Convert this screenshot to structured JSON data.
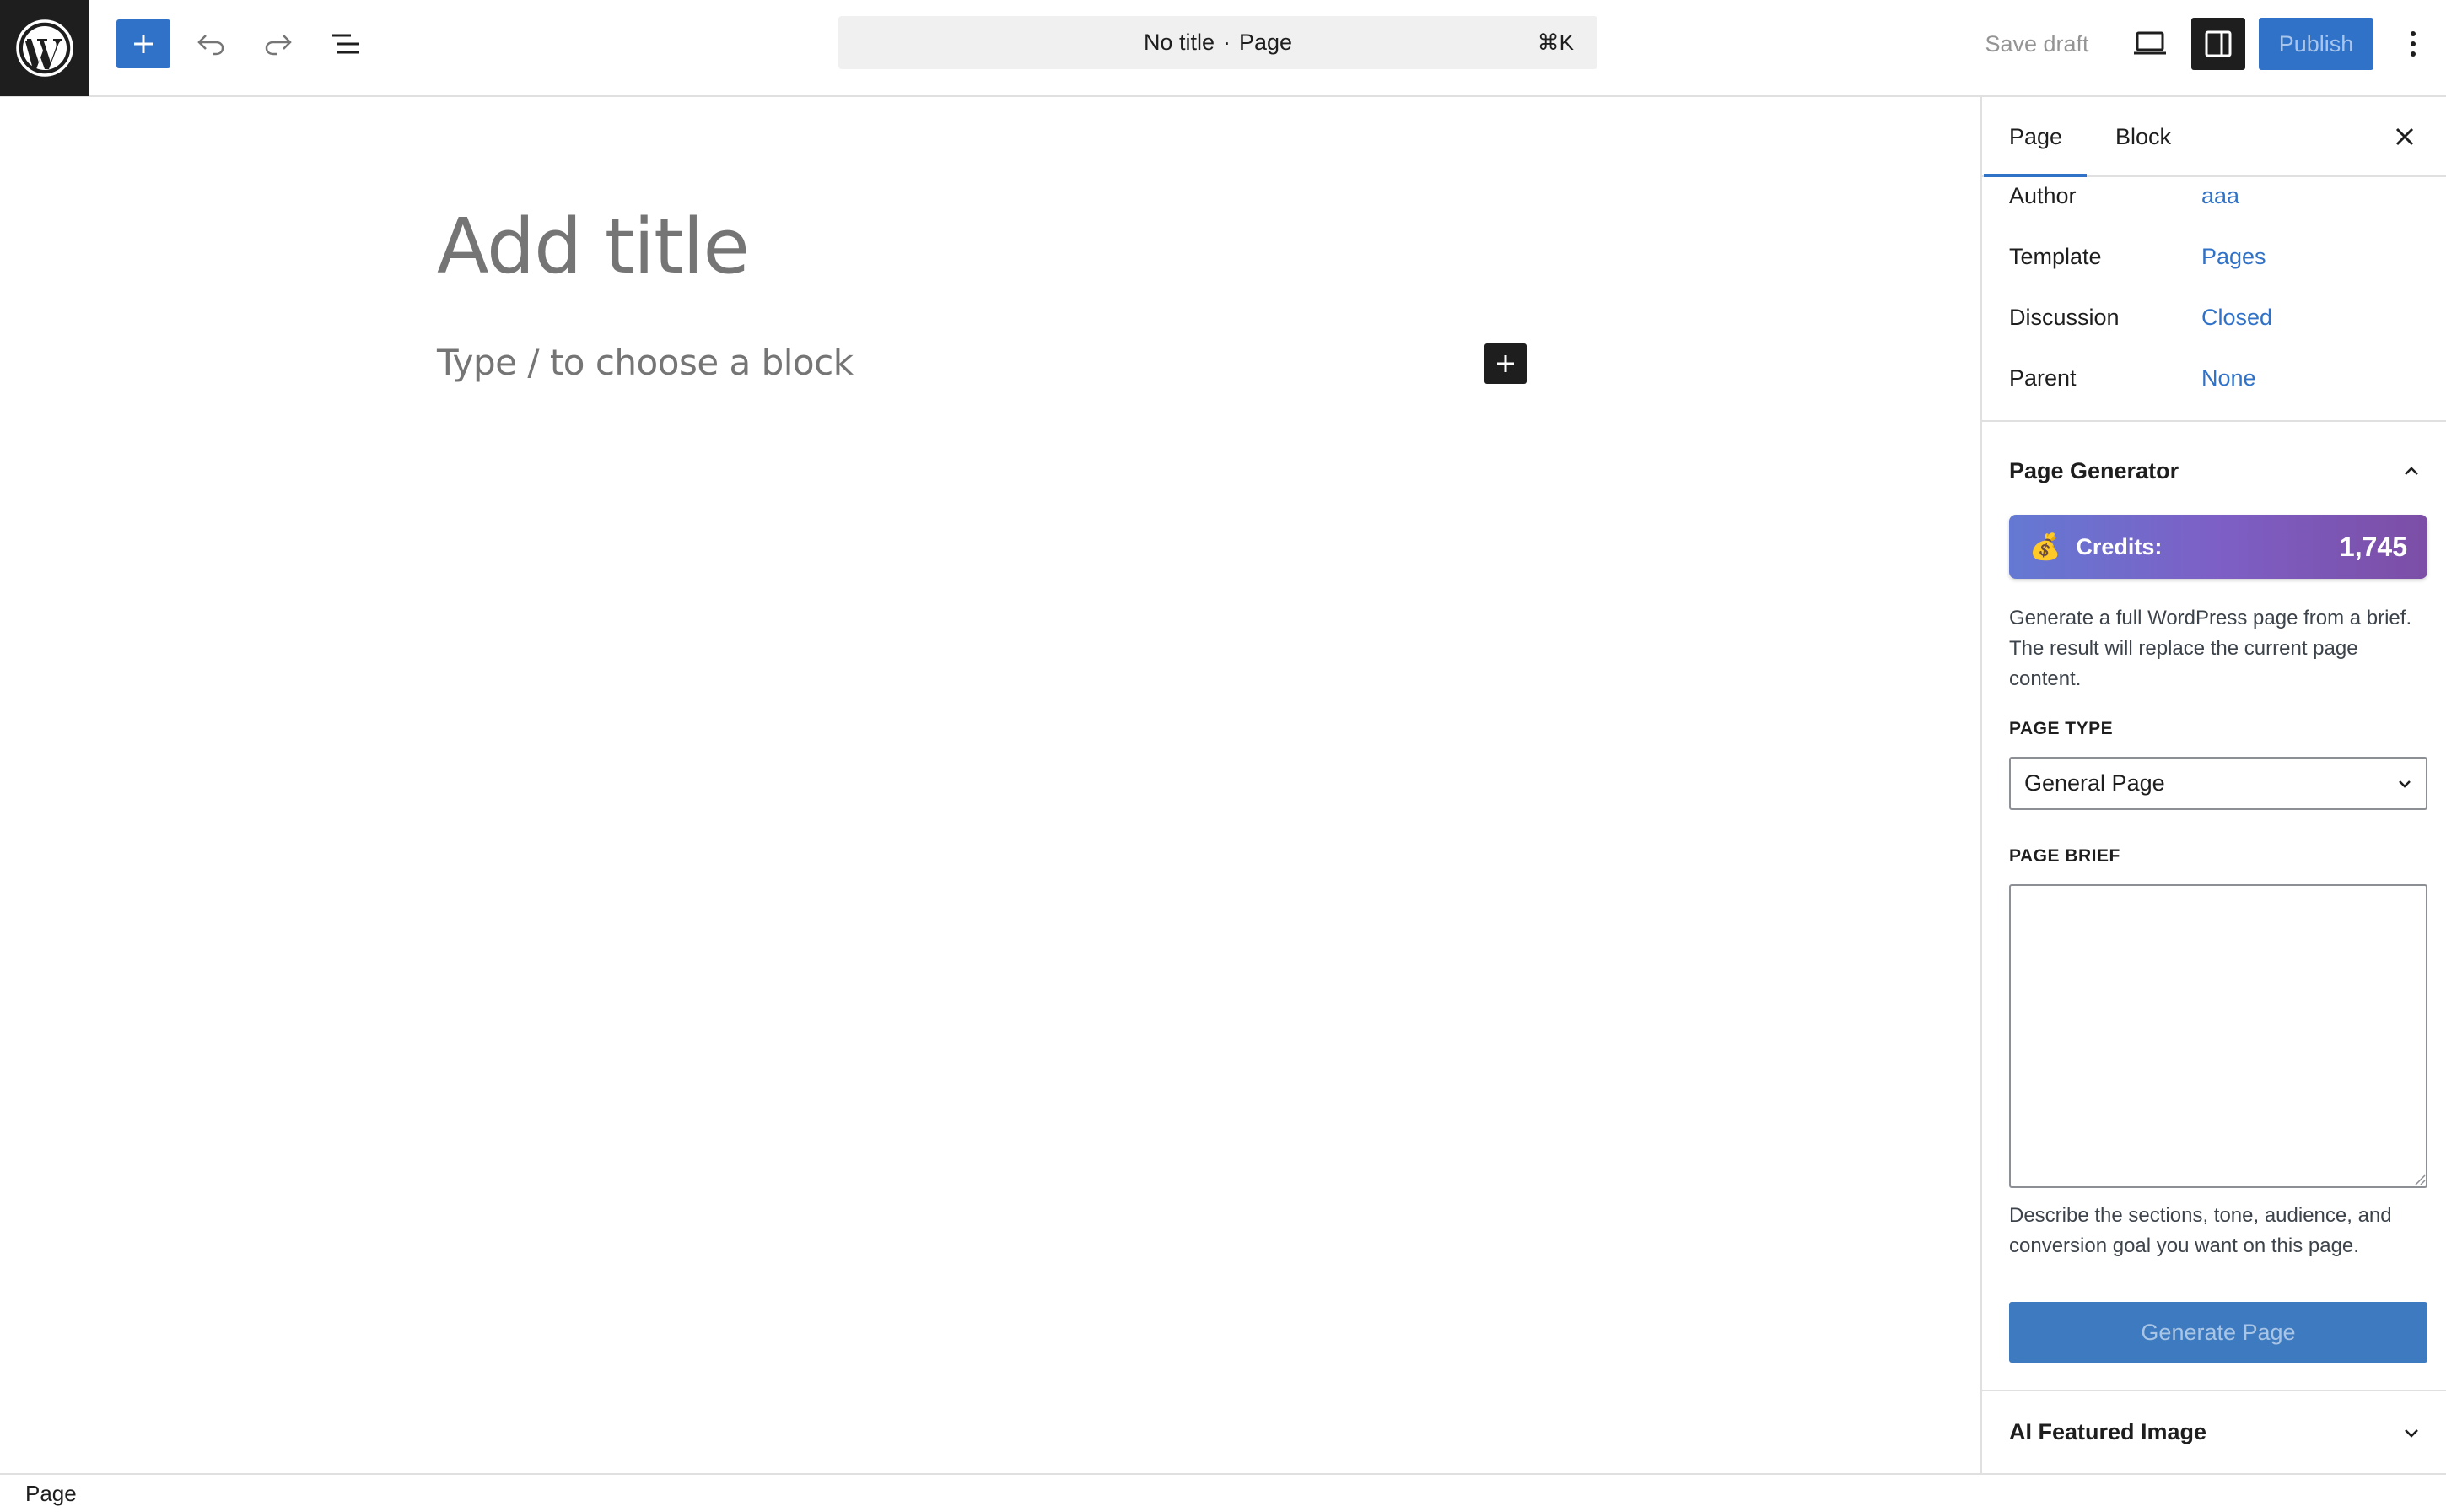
{
  "toolbar": {
    "document_title": "No title",
    "document_separator": "·",
    "document_type": "Page",
    "shortcut": "⌘K",
    "save_draft_label": "Save draft",
    "publish_label": "Publish"
  },
  "editor": {
    "title_placeholder": "Add title",
    "block_placeholder": "Type / to choose a block"
  },
  "sidebar": {
    "tabs": [
      {
        "label": "Page",
        "active": true
      },
      {
        "label": "Block",
        "active": false
      }
    ],
    "meta": [
      {
        "label": "Author",
        "value": "aaa"
      },
      {
        "label": "Template",
        "value": "Pages"
      },
      {
        "label": "Discussion",
        "value": "Closed"
      },
      {
        "label": "Parent",
        "value": "None"
      }
    ],
    "page_generator": {
      "title": "Page Generator",
      "credits_icon": "💰",
      "credits_label": "Credits:",
      "credits_value": "1,745",
      "description": "Generate a full WordPress page from a brief. The result will replace the current page content.",
      "page_type_label": "PAGE TYPE",
      "page_type_value": "General Page",
      "page_brief_label": "PAGE BRIEF",
      "page_brief_value": "",
      "page_brief_help": "Describe the sections, tone, audience, and conversion goal you want on this page.",
      "generate_label": "Generate Page"
    },
    "ai_featured_image": {
      "title": "AI Featured Image"
    }
  },
  "statusbar": {
    "breadcrumb": "Page"
  },
  "colors": {
    "accent": "#3072c8",
    "dark": "#1e1e1e",
    "credits_gradient_start": "#6479d3",
    "credits_gradient_end": "#7c4ea6"
  }
}
